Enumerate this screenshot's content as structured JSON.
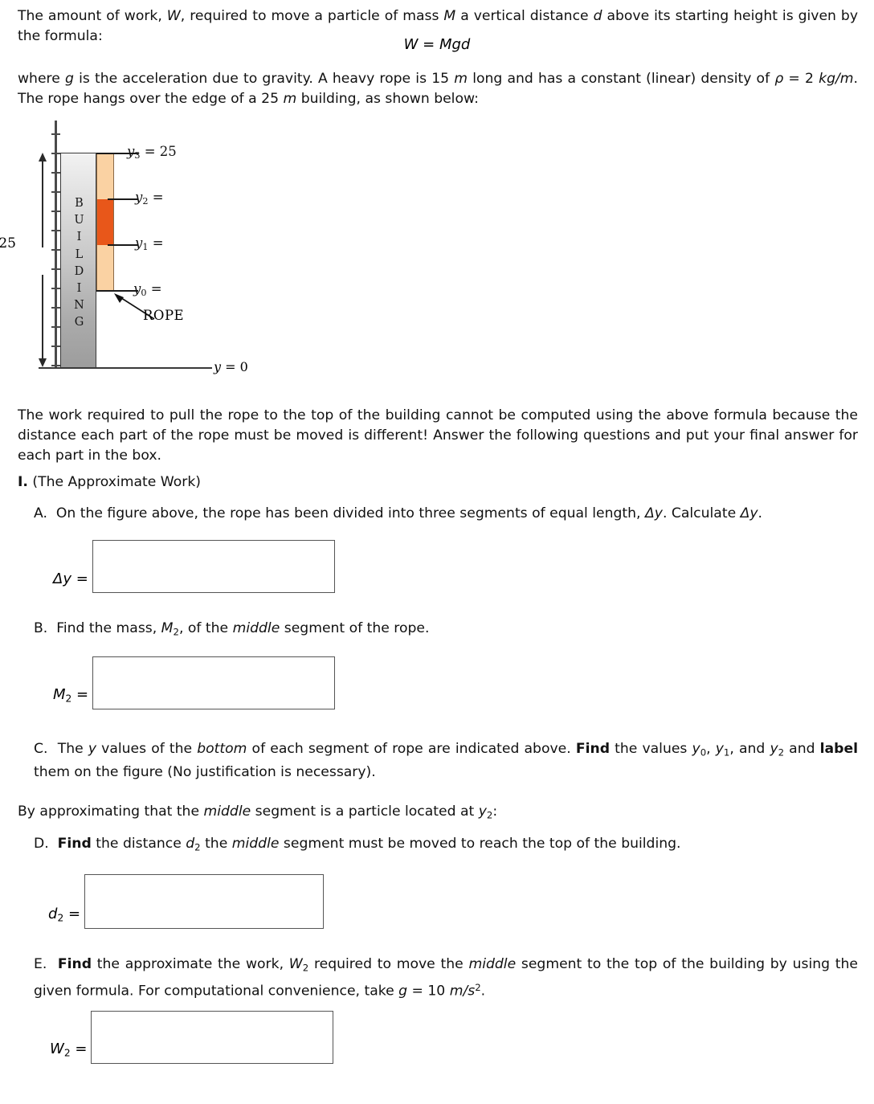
{
  "document": {
    "intro": {
      "line1_a": "The amount of work, ",
      "line1_W": "W",
      "line1_b": ", required to move a particle of mass ",
      "line1_M": "M",
      "line1_c": " a vertical distance ",
      "line1_d": "d",
      "line1_e": " above its starting height is given by the formula:",
      "formula": "W = Mgd",
      "line2_a": "where ",
      "line2_g": "g",
      "line2_b": " is the acceleration due to gravity.  A heavy rope is 15 ",
      "line2_m1": "m",
      "line2_c": " long and has a constant (linear) density of ",
      "line2_rho": "ρ",
      "line2_d": " = 2 ",
      "line2_units": "kg/m",
      "line2_e": ".  The rope hangs over the edge of a 25 ",
      "line2_m2": "m",
      "line2_f": " building, as shown below:"
    },
    "figure": {
      "building_text": "BUILDING",
      "building_letters": [
        "B",
        "U",
        "I",
        "L",
        "D",
        "I",
        "N",
        "G"
      ],
      "rope_callout": "ROPE",
      "dimension_value": "25",
      "ground_label_y": "y",
      "ground_label_eq": " = 0",
      "y_labels": [
        {
          "name": "y3",
          "base": "y",
          "sub": "3",
          "eq": " = 25"
        },
        {
          "name": "y2",
          "base": "y",
          "sub": "2",
          "eq": " ="
        },
        {
          "name": "y1",
          "base": "y",
          "sub": "1",
          "eq": " ="
        },
        {
          "name": "y0",
          "base": "y",
          "sub": "0",
          "eq": " ="
        }
      ],
      "segment_colors": {
        "top": "#fad2a3",
        "middle": "#e8571a",
        "bottom": "#fad2a3",
        "building_top": "#f2f2f2",
        "building_bottom": "#9d9d9d"
      },
      "segments": 3,
      "rope_length_m": 15,
      "building_height_m": 25
    },
    "body": {
      "paragraph2": "The work required to pull the rope to the top of the building cannot be computed using the above formula because the distance each part of the rope must be moved is different!  Answer the following questions and put your final answer for each part in the box.",
      "section_I_num": "I.",
      "section_I_title": " (The Approximate Work)",
      "partA_letter": "A.",
      "partA_a": "On the figure above, the rope has been divided into three segments of equal length, ",
      "partA_dy": "Δy",
      "partA_b": ".  Calculate ",
      "partA_dy2": "Δy",
      "partA_c": ".",
      "boxA_label_sym": "Δy",
      "boxA_label_eq": " =",
      "partB_letter": "B.",
      "partB_a": "Find the mass, ",
      "partB_M": "M",
      "partB_M_sub": "2",
      "partB_b": ", of the ",
      "partB_middle": "middle",
      "partB_c": " segment of the rope.",
      "boxB_label_sym": "M",
      "boxB_label_sub": "2",
      "boxB_label_eq": " =",
      "partC_letter": "C.",
      "partC_a": "The ",
      "partC_y": "y",
      "partC_b": " values of the ",
      "partC_bottom": "bottom",
      "partC_c": " of each segment of rope are indicated above.  ",
      "partC_find": "Find",
      "partC_d": " the values ",
      "partC_y0": "y",
      "partC_y0s": "0",
      "partC_e": ", ",
      "partC_y1": "y",
      "partC_y1s": "1",
      "partC_f": ", and ",
      "partC_y2": "y",
      "partC_y2s": "2",
      "partC_g": " and ",
      "partC_label": "label",
      "partC_h": " them on the figure (No justification is necessary).",
      "paragraph3_a": "By approximating that the ",
      "paragraph3_middle": "middle",
      "paragraph3_b": " segment is a particle located at ",
      "paragraph3_y2": "y",
      "paragraph3_y2s": "2",
      "paragraph3_c": ":",
      "partD_letter": "D.",
      "partD_find": "Find",
      "partD_a": " the distance ",
      "partD_d2": "d",
      "partD_d2s": "2",
      "partD_b": " the ",
      "partD_middle": "middle",
      "partD_c": " segment must be moved to reach the top of the building.",
      "boxD_label_sym": "d",
      "boxD_label_sub": "2",
      "boxD_label_eq": " =",
      "partE_letter": "E.",
      "partE_find": "Find",
      "partE_a": " the approximate the work, ",
      "partE_W": "W",
      "partE_Ws": "2",
      "partE_b": " required to move the ",
      "partE_middle": "middle",
      "partE_c": " segment to the top of the building by using the given formula.  For computational convenience, take ",
      "partE_g": "g",
      "partE_d": " = 10 ",
      "partE_units": "m/s",
      "partE_units_sup": "2",
      "partE_e": ".",
      "boxE_label_sym": "W",
      "boxE_label_sub": "2",
      "boxE_label_eq": " ="
    }
  }
}
